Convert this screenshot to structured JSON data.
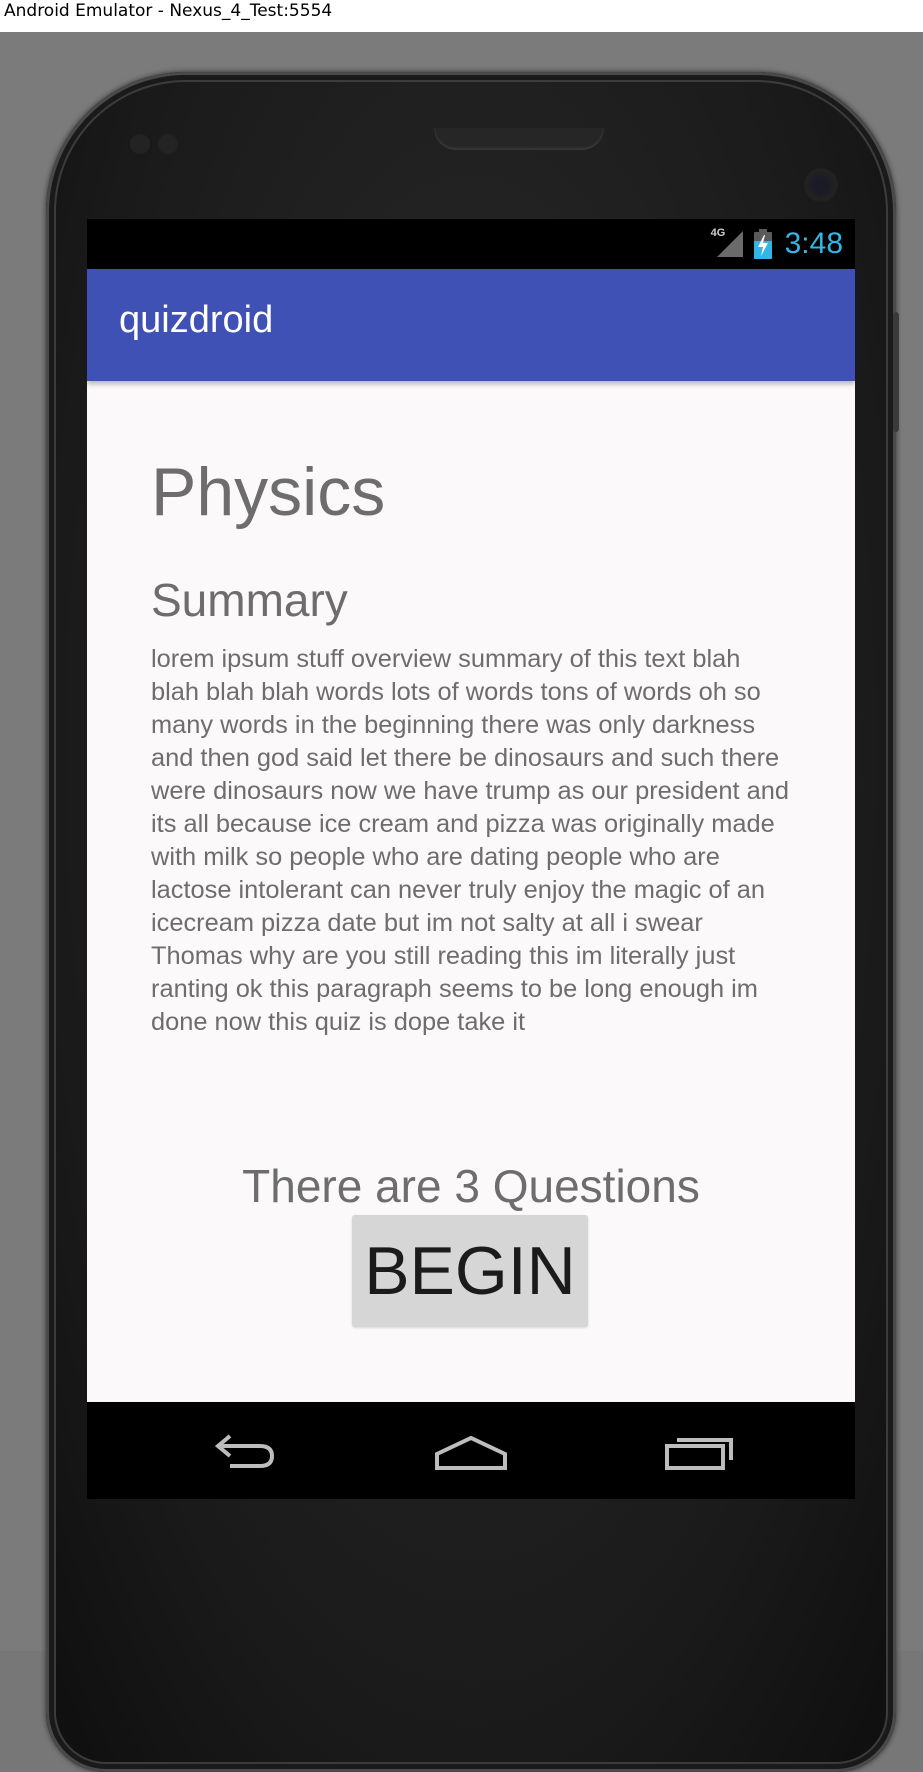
{
  "window": {
    "title": "Android Emulator - Nexus_4_Test:5554"
  },
  "status_bar": {
    "network_type": "4G",
    "signal_icon": "cell-signal-icon",
    "battery_icon": "battery-charging-icon",
    "time": "3:48",
    "clock_color": "#33b5e5"
  },
  "app_bar": {
    "title": "quizdroid",
    "color": "#3f51b5"
  },
  "topic": {
    "title": "Physics",
    "summary_heading": "Summary",
    "summary_text": "lorem ipsum stuff overview summary of this text blah blah blah blah words lots of words tons of words oh so many words in the beginning there was only darkness and then god said let there be dinosaurs and such there were dinosaurs now we have trump as our president and its all because ice cream and pizza was originally made with milk so people who are dating people who are lactose intolerant can never truly enjoy the magic of an icecream pizza date but im not salty at all i swear Thomas why are you still reading this im literally just ranting ok this paragraph seems to be long enough im done now this quiz is dope take it",
    "question_count_text": "There are 3 Questions",
    "begin_label": "BEGIN"
  },
  "nav_bar": {
    "back_icon": "back-icon",
    "home_icon": "home-icon",
    "recents_icon": "recents-icon"
  }
}
